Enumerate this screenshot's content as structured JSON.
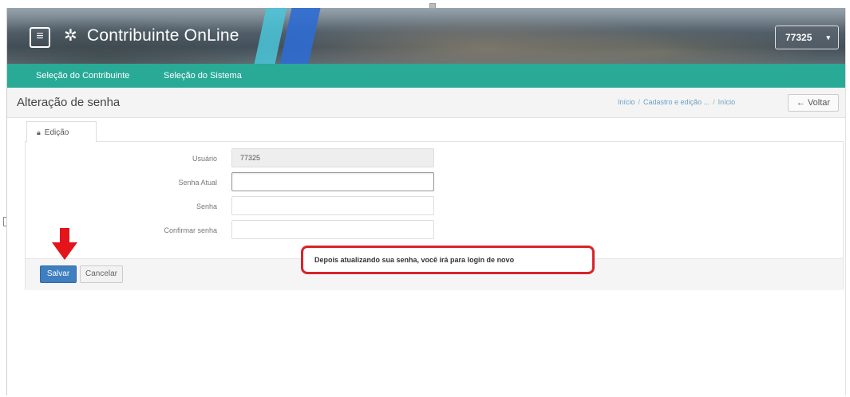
{
  "header": {
    "brand": "Contribuinte OnLine",
    "menu_icon": "hamburger-icon",
    "user_dropdown": "77325",
    "user_caret": "▾"
  },
  "navbar": {
    "items": [
      "Seleção do Contribuinte",
      "Seleção do Sistema"
    ]
  },
  "page": {
    "title": "Alteração de senha",
    "breadcrumb": [
      "Início",
      "Cadastro e edição ...",
      "Início"
    ],
    "back_label": "Voltar",
    "back_icon": "←"
  },
  "tab": {
    "label": "Edição"
  },
  "form": {
    "fields": [
      {
        "label": "Usuário",
        "value": "77325",
        "readonly": true
      },
      {
        "label": "Senha Atual",
        "value": ""
      },
      {
        "label": "Senha",
        "value": ""
      },
      {
        "label": "Confirmar senha",
        "value": ""
      }
    ]
  },
  "actions": {
    "save": "Salvar",
    "cancel": "Cancelar"
  },
  "annotation": {
    "text": "Depois atualizando sua senha, você irá para login de novo",
    "color": "#d8232a"
  },
  "colors": {
    "navbar": "#28aa97",
    "primary": "#3f7fc0",
    "arrow": "#e3141a"
  }
}
